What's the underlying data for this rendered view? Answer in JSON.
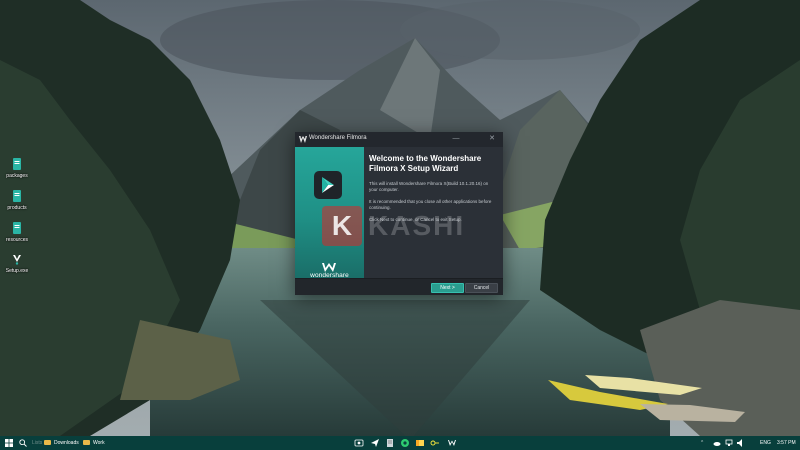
{
  "desktop": {
    "icons": [
      {
        "label": "packages",
        "icon": "folder-file-icon"
      },
      {
        "label": "products",
        "icon": "folder-file-icon"
      },
      {
        "label": "resources",
        "icon": "folder-file-icon"
      },
      {
        "label": "Setup.exe",
        "icon": "setup-exe-icon"
      }
    ]
  },
  "installer": {
    "title": "Wondershare Filmora",
    "heading_line1": "Welcome to the Wondershare",
    "heading_line2": "Filmora X Setup Wizard",
    "paragraph1": "This will install Wondershare Filmora X(Build 10.1.20.16) on your computer.",
    "paragraph2": "It is recommended that you close all other applications before continuing.",
    "paragraph3": "Click Next to continue, or Cancel to exit Setup.",
    "brand": "wondershare",
    "next_label": "Next >",
    "cancel_label": "Cancel",
    "accent_color": "#26a69a"
  },
  "watermark": {
    "logo_letter": "K",
    "text": "KASHI"
  },
  "taskbar": {
    "items": [
      {
        "label": "Lists",
        "active": false
      },
      {
        "label": "Downloads",
        "active": true
      },
      {
        "label": "Work",
        "active": true
      }
    ],
    "tray": {
      "language": "ENG",
      "time": "3:57 PM"
    }
  }
}
